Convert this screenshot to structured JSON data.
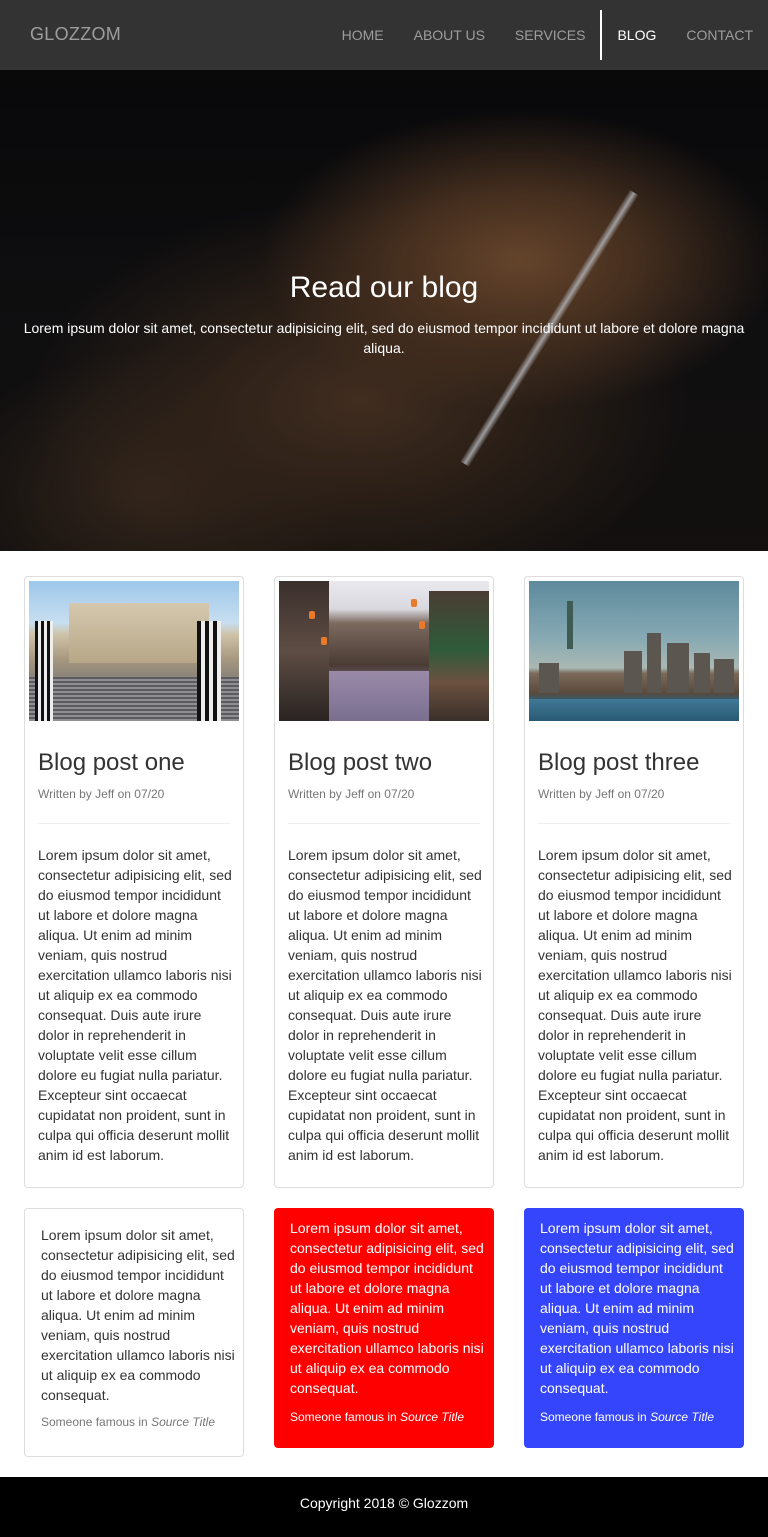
{
  "navbar": {
    "brand": "GLOZZOM",
    "items": [
      {
        "label": "HOME"
      },
      {
        "label": "ABOUT US"
      },
      {
        "label": "SERVICES"
      },
      {
        "label": "BLOG"
      },
      {
        "label": "CONTACT"
      }
    ],
    "active": "BLOG"
  },
  "hero": {
    "title": "Read our blog",
    "text": "Lorem ipsum dolor sit amet, consectetur adipisicing elit, sed do eiusmod tempor incididunt ut labore et dolore magna aliqua."
  },
  "posts": [
    {
      "title": "Blog post one",
      "byline": "Written by Jeff on 07/20",
      "body": "Lorem ipsum dolor sit amet, consectetur adipisicing elit, sed do eiusmod tempor incididunt ut labore et dolore magna aliqua. Ut enim ad minim veniam, quis nostrud exercitation ullamco laboris nisi ut aliquip ex ea commodo consequat. Duis aute irure dolor in reprehenderit in voluptate velit esse cillum dolore eu fugiat nulla pariatur. Excepteur sint occaecat cupidatat non proident, sunt in culpa qui officia deserunt mollit anim id est laborum."
    },
    {
      "title": "Blog post two",
      "byline": "Written by Jeff on 07/20",
      "body": "Lorem ipsum dolor sit amet, consectetur adipisicing elit, sed do eiusmod tempor incididunt ut labore et dolore magna aliqua. Ut enim ad minim veniam, quis nostrud exercitation ullamco laboris nisi ut aliquip ex ea commodo consequat. Duis aute irure dolor in reprehenderit in voluptate velit esse cillum dolore eu fugiat nulla pariatur. Excepteur sint occaecat cupidatat non proident, sunt in culpa qui officia deserunt mollit anim id est laborum."
    },
    {
      "title": "Blog post three",
      "byline": "Written by Jeff on 07/20",
      "body": "Lorem ipsum dolor sit amet, consectetur adipisicing elit, sed do eiusmod tempor incididunt ut labore et dolore magna aliqua. Ut enim ad minim veniam, quis nostrud exercitation ullamco laboris nisi ut aliquip ex ea commodo consequat. Duis aute irure dolor in reprehenderit in voluptate velit esse cillum dolore eu fugiat nulla pariatur. Excepteur sint occaecat cupidatat non proident, sunt in culpa qui officia deserunt mollit anim id est laborum."
    }
  ],
  "quotes": [
    {
      "text": "Lorem ipsum dolor sit amet, consectetur adipisicing elit, sed do eiusmod tempor incididunt ut labore et dolore magna aliqua. Ut enim ad minim veniam, quis nostrud exercitation ullamco laboris nisi ut aliquip ex ea commodo consequat.",
      "author": "Someone famous in",
      "source": "Source Title",
      "color": "#ffffff"
    },
    {
      "text": "Lorem ipsum dolor sit amet, consectetur adipisicing elit, sed do eiusmod tempor incididunt ut labore et dolore magna aliqua. Ut enim ad minim veniam, quis nostrud exercitation ullamco laboris nisi ut aliquip ex ea commodo consequat.",
      "author": "Someone famous in",
      "source": "Source Title",
      "color": "#ff0000"
    },
    {
      "text": "Lorem ipsum dolor sit amet, consectetur adipisicing elit, sed do eiusmod tempor incididunt ut labore et dolore magna aliqua. Ut enim ad minim veniam, quis nostrud exercitation ullamco laboris nisi ut aliquip ex ea commodo consequat.",
      "author": "Someone famous in",
      "source": "Source Title",
      "color": "#3545fb"
    }
  ],
  "footer": {
    "text": "Copyright 2018 © Glozzom"
  },
  "colors": {
    "navbar_bg": "#333333",
    "footer_bg": "#000000",
    "nav_text": "#9d9d9d",
    "nav_active": "#ffffff"
  }
}
